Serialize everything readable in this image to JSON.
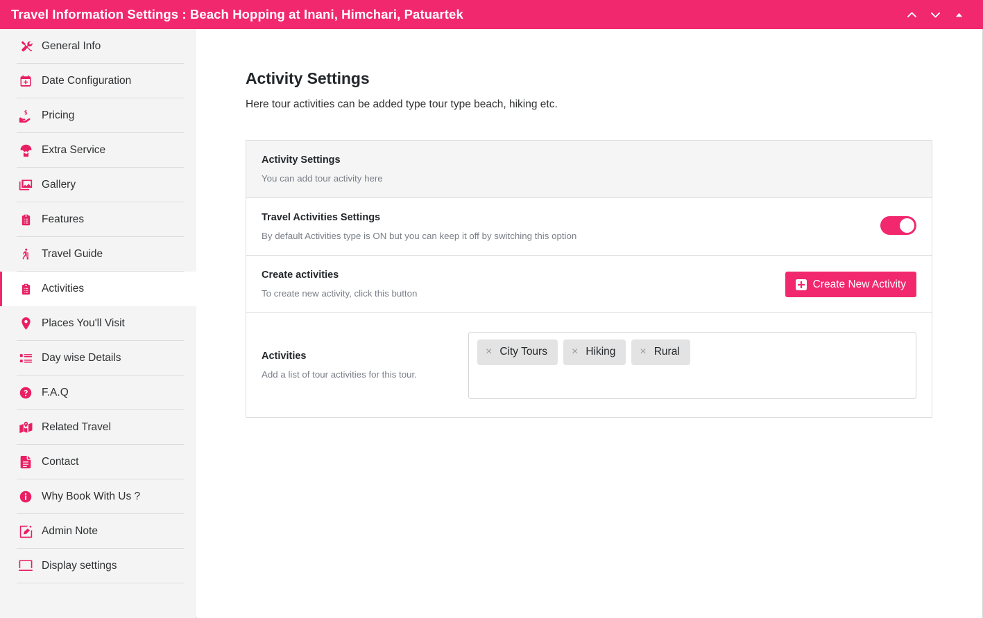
{
  "window": {
    "title": "Travel Information Settings : Beach Hopping at Inani, Himchari, Patuartek",
    "controls": [
      {
        "name": "chevron-up-icon",
        "label": "Previous"
      },
      {
        "name": "chevron-down-icon",
        "label": "Next"
      },
      {
        "name": "triangle-up-icon",
        "label": "Collapse"
      }
    ],
    "accent_color": "#f2286e"
  },
  "sidebar": {
    "items": [
      {
        "label": "General Info",
        "icon": "tools-icon",
        "active": false
      },
      {
        "label": "Date Configuration",
        "icon": "calendar-plus-icon",
        "active": false
      },
      {
        "label": "Pricing",
        "icon": "hand-holding-dollar-icon",
        "active": false
      },
      {
        "label": "Extra Service",
        "icon": "parachute-box-icon",
        "active": false
      },
      {
        "label": "Gallery",
        "icon": "images-icon",
        "active": false
      },
      {
        "label": "Features",
        "icon": "clipboard-list-icon",
        "active": false
      },
      {
        "label": "Travel Guide",
        "icon": "hiking-person-icon",
        "active": false
      },
      {
        "label": "Activities",
        "icon": "clipboard-list-icon",
        "active": true
      },
      {
        "label": "Places You'll Visit",
        "icon": "map-marker-icon",
        "active": false
      },
      {
        "label": "Day wise Details",
        "icon": "list-ul-icon",
        "active": false
      },
      {
        "label": "F.A.Q",
        "icon": "question-circle-icon",
        "active": false
      },
      {
        "label": "Related Travel",
        "icon": "map-marked-icon",
        "active": false
      },
      {
        "label": "Contact",
        "icon": "file-lines-icon",
        "active": false
      },
      {
        "label": "Why Book With Us ?",
        "icon": "info-circle-icon",
        "active": false
      },
      {
        "label": "Admin Note",
        "icon": "pen-square-icon",
        "active": false
      },
      {
        "label": "Display settings",
        "icon": "display-icon",
        "active": false
      }
    ]
  },
  "main": {
    "title": "Activity Settings",
    "subtitle": "Here tour activities can be added type tour type beach, hiking etc.",
    "sections": {
      "intro": {
        "title": "Activity Settings",
        "desc": "You can add tour activity here"
      },
      "travel_activities": {
        "title": "Travel Activities Settings",
        "desc": "By default Activities type is ON but you can keep it off by switching this option",
        "toggle_state": "on"
      },
      "create": {
        "title": "Create activities",
        "desc": "To create new activity, click this button",
        "button_label": "Create New Activity"
      },
      "activities": {
        "title": "Activities",
        "desc": "Add a list of tour activities for this tour.",
        "tags": [
          {
            "label": "City Tours",
            "remove": "×"
          },
          {
            "label": "Hiking",
            "remove": "×"
          },
          {
            "label": "Rural",
            "remove": "×"
          }
        ]
      }
    }
  }
}
